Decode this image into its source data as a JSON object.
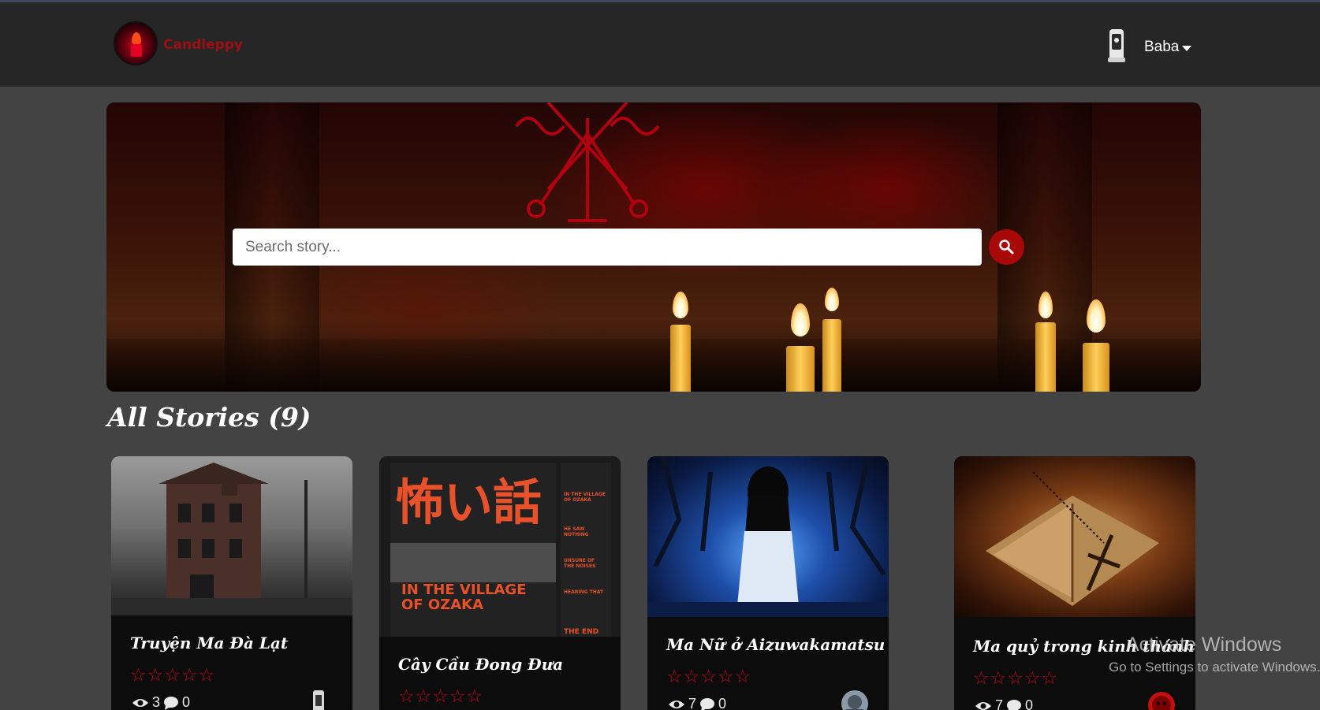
{
  "navbar": {
    "brand_name": "Candleppy",
    "user_name": "Baba"
  },
  "search": {
    "placeholder": "Search story..."
  },
  "section": {
    "title": "All Stories (9)"
  },
  "stories": [
    {
      "title": "Truyện Ma Đà Lạt",
      "rating_stars": "☆☆☆☆☆",
      "views": "3",
      "comments": "0",
      "cover": "haunted-house-image",
      "author_avatar": "ghost-avatar"
    },
    {
      "title": "Cây Cầu Đong Đưa",
      "rating_stars": "☆☆☆☆☆",
      "views": "",
      "comments": "",
      "cover": "manga-poster-image",
      "cover_text": {
        "kanji": "怖い話",
        "headline": "IN THE VILLAGE OF OZAKA",
        "side_1": "IN THE VILLAGE OF OZAKA",
        "side_2": "HE SAW NOTHING",
        "side_3": "UNSURE OF THE NOISES",
        "side_4": "HEARING THAT",
        "side_5": "THE END"
      }
    },
    {
      "title": "Ma Nữ ở Aizuwakamatsu",
      "rating_stars": "☆☆☆☆☆",
      "views": "7",
      "comments": "0",
      "cover": "ghost-girl-image",
      "author_avatar": "anime-avatar"
    },
    {
      "title": "Ma quỷ trong kinh thánh",
      "rating_stars": "☆☆☆☆☆",
      "views": "7",
      "comments": "0",
      "cover": "bible-cross-image",
      "author_avatar": "red-mask-avatar"
    }
  ],
  "watermark": {
    "line1": "Activate Windows",
    "line2": "Go to Settings to activate Windows."
  },
  "colors": {
    "navbar_bg": "#262626",
    "page_bg": "#434343",
    "accent_red": "#a80808",
    "brand_red": "#9c0f12",
    "card_bg": "#0c0c0c"
  }
}
